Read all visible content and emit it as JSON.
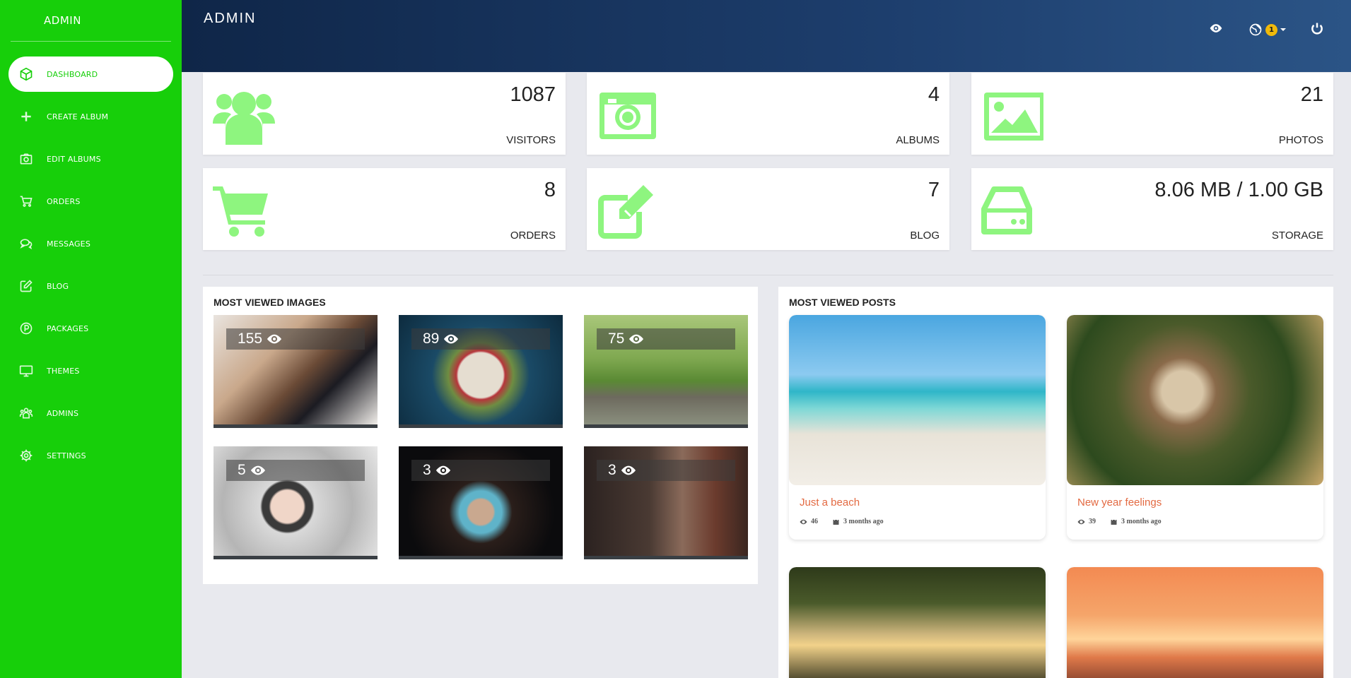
{
  "sidebar": {
    "brand": "ADMIN",
    "items": [
      {
        "label": "DASHBOARD",
        "icon": "cube-icon",
        "active": true
      },
      {
        "label": "CREATE ALBUM",
        "icon": "plus-icon"
      },
      {
        "label": "EDIT ALBUMS",
        "icon": "camera-icon"
      },
      {
        "label": "ORDERS",
        "icon": "cart-icon"
      },
      {
        "label": "MESSAGES",
        "icon": "chat-icon"
      },
      {
        "label": "BLOG",
        "icon": "edit-icon"
      },
      {
        "label": "PACKAGES",
        "icon": "p-circle-icon"
      },
      {
        "label": "THEMES",
        "icon": "monitor-icon"
      },
      {
        "label": "ADMINS",
        "icon": "users-icon"
      },
      {
        "label": "SETTINGS",
        "icon": "gear-icon"
      }
    ]
  },
  "header": {
    "title": "ADMIN",
    "notification_count": "1"
  },
  "stats": [
    {
      "value": "1087",
      "label": "VISITORS",
      "icon": "users-icon"
    },
    {
      "value": "4",
      "label": "ALBUMS",
      "icon": "camera-icon"
    },
    {
      "value": "21",
      "label": "PHOTOS",
      "icon": "image-icon"
    },
    {
      "value": "8",
      "label": "ORDERS",
      "icon": "cart-icon"
    },
    {
      "value": "7",
      "label": "BLOG",
      "icon": "edit-icon"
    },
    {
      "value": "8.06 MB / 1.00 GB",
      "label": "STORAGE",
      "icon": "hdd-icon"
    }
  ],
  "most_viewed_images": {
    "title": "MOST VIEWED IMAGES",
    "items": [
      {
        "views": "155"
      },
      {
        "views": "89"
      },
      {
        "views": "75"
      },
      {
        "views": "5"
      },
      {
        "views": "3"
      },
      {
        "views": "3"
      }
    ]
  },
  "most_viewed_posts": {
    "title": "MOST VIEWED POSTS",
    "items": [
      {
        "title": "Just a beach",
        "views": "46",
        "date": "3 months ago"
      },
      {
        "title": "New year feelings",
        "views": "39",
        "date": "3 months ago"
      }
    ]
  },
  "colors": {
    "sidebar": "#17cf0a",
    "icon_green": "#8ef57f",
    "post_title": "#e36a42",
    "badge": "#f0b90b"
  }
}
